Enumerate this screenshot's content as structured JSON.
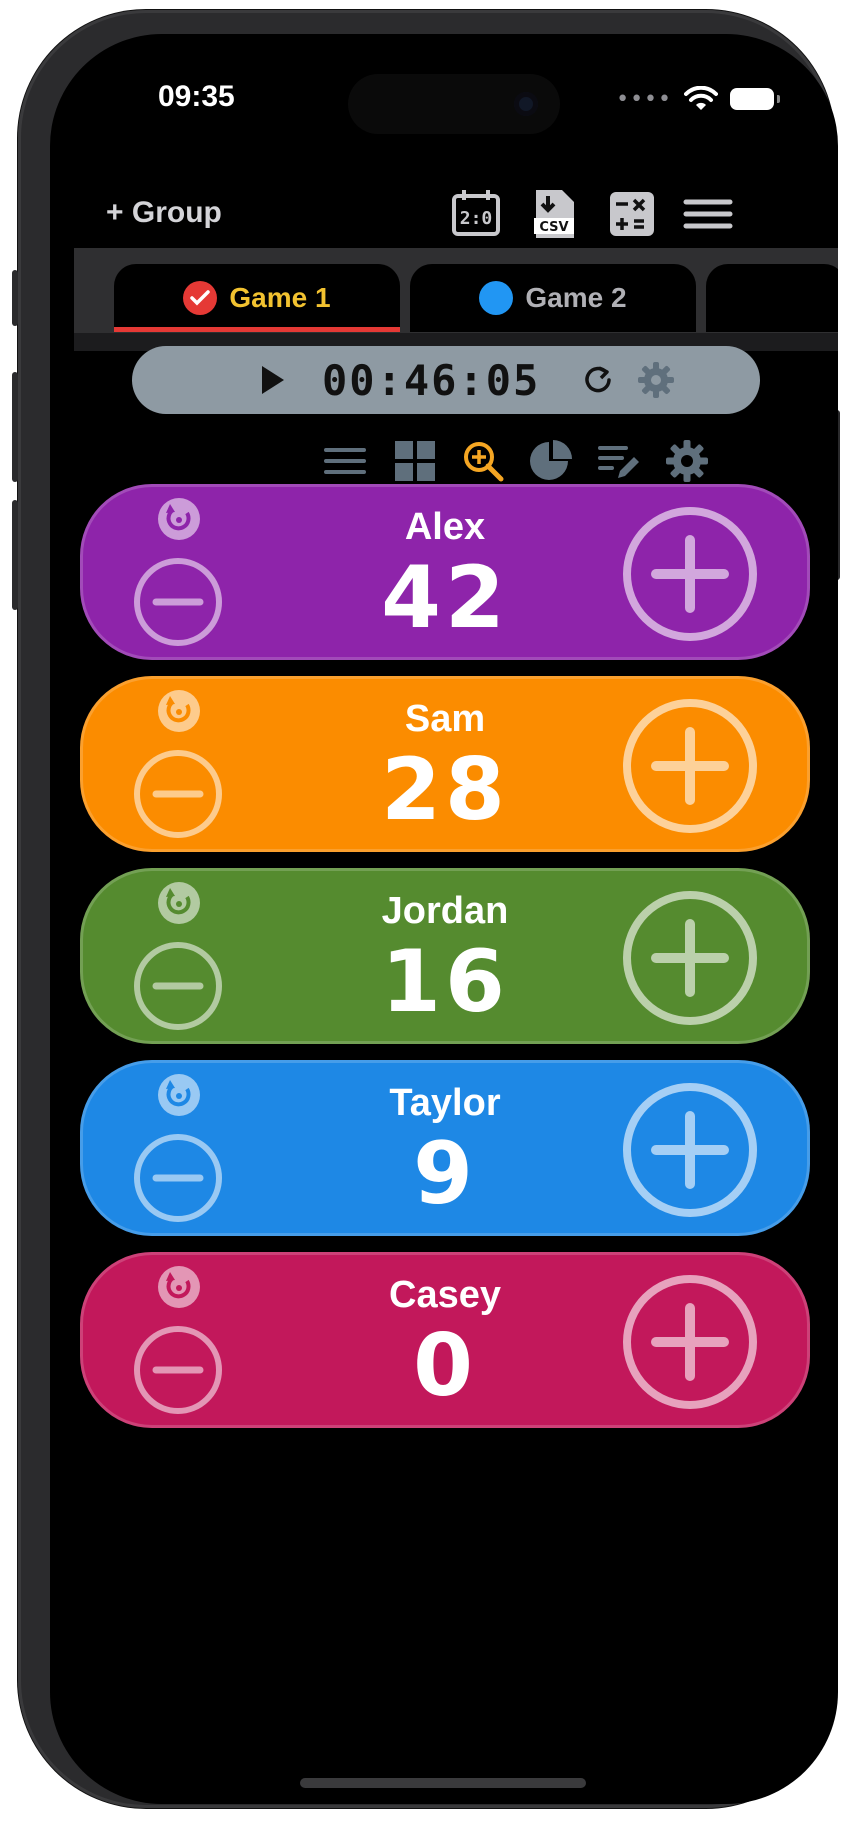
{
  "status_bar": {
    "time": "09:35"
  },
  "toolbar": {
    "add_group_label": "+ Group",
    "scoreboard_icon_text": "2:0",
    "csv_icon_text": "CSV"
  },
  "tabs": [
    {
      "label": "Game 1",
      "active": true,
      "label_color": "#f2c230",
      "marker": "checkmark",
      "marker_color": "#e53935"
    },
    {
      "label": "Game 2",
      "active": false,
      "label_color": "#b0b0b5",
      "marker": "dot",
      "marker_color": "#2196f3"
    }
  ],
  "timer": {
    "display": "00:46:05"
  },
  "players": [
    {
      "name": "Alex",
      "score": "42",
      "color": "#8e24aa"
    },
    {
      "name": "Sam",
      "score": "28",
      "color": "#fb8c00"
    },
    {
      "name": "Jordan",
      "score": "16",
      "color": "#558b2f"
    },
    {
      "name": "Taylor",
      "score": "9",
      "color": "#1e88e5"
    },
    {
      "name": "Casey",
      "score": "0",
      "color": "#c2185b"
    }
  ],
  "colors": {
    "accent": "#f5a623",
    "icon_gray": "#607080"
  }
}
